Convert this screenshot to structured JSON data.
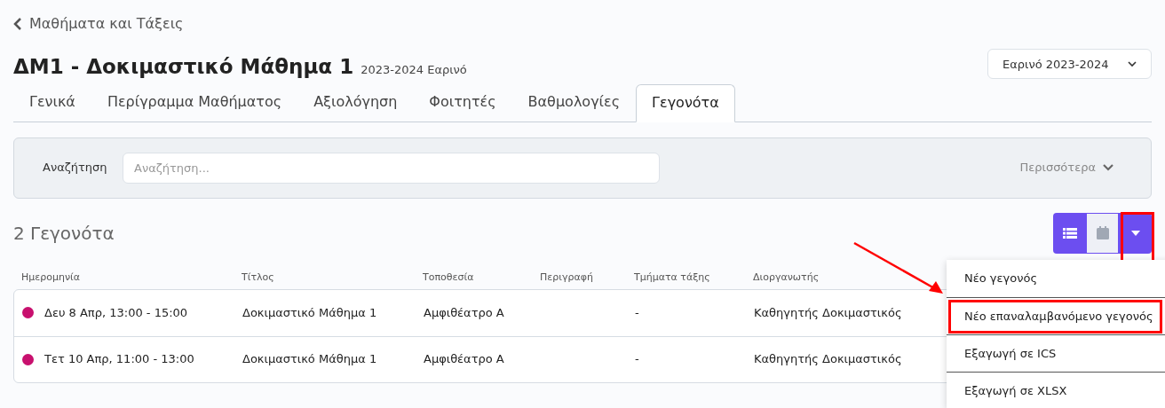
{
  "back_link": "Μαθήματα και Τάξεις",
  "course": {
    "title": "ΔΜ1 - Δοκιμαστικό Μάθημα 1",
    "term": "2023-2024 Εαρινό"
  },
  "term_select": {
    "value": "Εαρινό 2023-2024"
  },
  "tabs": [
    {
      "label": "Γενικά",
      "selected": false
    },
    {
      "label": "Περίγραμμα Μαθήματος",
      "selected": false
    },
    {
      "label": "Αξιολόγηση",
      "selected": false
    },
    {
      "label": "Φοιτητές",
      "selected": false
    },
    {
      "label": "Βαθμολογίες",
      "selected": false
    },
    {
      "label": "Γεγονότα",
      "selected": true
    }
  ],
  "search": {
    "label": "Αναζήτηση",
    "placeholder": "Αναζήτηση...",
    "more": "Περισσότερα"
  },
  "count": "2 Γεγονότα",
  "view_buttons": [
    {
      "kind": "list",
      "selected": true
    },
    {
      "kind": "calendar",
      "selected": false
    },
    {
      "kind": "menu",
      "selected": true,
      "annotated": true
    }
  ],
  "table": {
    "columns": [
      "Ημερομηνία",
      "Τίτλος",
      "Τοποθεσία",
      "Περιγραφή",
      "Τμήματα τάξης",
      "Διοργανωτής"
    ],
    "rows": [
      {
        "color": "#c8106e",
        "cells": [
          "Δευ 8 Απρ, 13:00 - 15:00",
          "Δοκιμαστικό Μάθημα 1",
          "Αμφιθέατρο Α",
          "",
          "-",
          "Καθηγητής Δοκιμαστικός"
        ]
      },
      {
        "color": "#c8106e",
        "cells": [
          "Τετ 10 Απρ, 11:00 - 13:00",
          "Δοκιμαστικό Μάθημα 1",
          "Αμφιθέατρο Α",
          "",
          "-",
          "Καθηγητής Δοκιμαστικός"
        ]
      }
    ]
  },
  "menu": [
    {
      "label": "Νέο γεγονός",
      "annotated": false
    },
    {
      "label": "Νέο επαναλαμβανόμενο γεγονός",
      "annotated": true
    },
    {
      "label": "Εξαγωγή σε ICS",
      "annotated": false
    },
    {
      "label": "Εξαγωγή σε XLSX",
      "annotated": false
    }
  ]
}
